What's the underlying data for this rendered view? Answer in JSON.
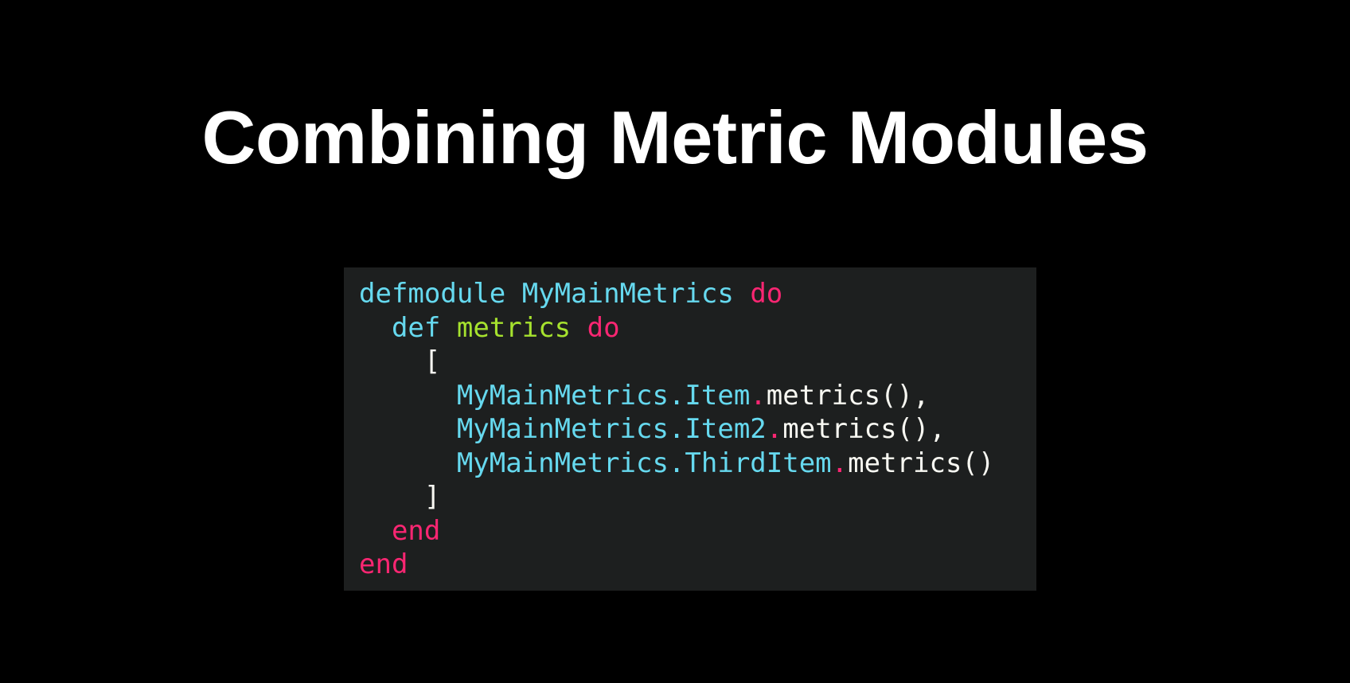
{
  "slide": {
    "title": "Combining Metric Modules"
  },
  "colors": {
    "background": "#000000",
    "code_background": "#1d1f1f",
    "keyword_blue": "#66d9ef",
    "keyword_red": "#f92672",
    "function_green": "#a6e22e",
    "plain_text": "#f8f8f2"
  },
  "code": {
    "language": "elixir",
    "lines": [
      [
        {
          "t": "defmodule",
          "c": "kw"
        },
        {
          "t": " ",
          "c": "plain"
        },
        {
          "t": "MyMainMetrics",
          "c": "type"
        },
        {
          "t": " ",
          "c": "plain"
        },
        {
          "t": "do",
          "c": "red"
        }
      ],
      [
        {
          "t": "  ",
          "c": "plain"
        },
        {
          "t": "def",
          "c": "kw"
        },
        {
          "t": " ",
          "c": "plain"
        },
        {
          "t": "metrics",
          "c": "fn"
        },
        {
          "t": " ",
          "c": "plain"
        },
        {
          "t": "do",
          "c": "red"
        }
      ],
      [
        {
          "t": "    [",
          "c": "plain"
        }
      ],
      [
        {
          "t": "      ",
          "c": "plain"
        },
        {
          "t": "MyMainMetrics.Item",
          "c": "type"
        },
        {
          "t": ".",
          "c": "red"
        },
        {
          "t": "metrics(),",
          "c": "plain"
        }
      ],
      [
        {
          "t": "      ",
          "c": "plain"
        },
        {
          "t": "MyMainMetrics.Item2",
          "c": "type"
        },
        {
          "t": ".",
          "c": "red"
        },
        {
          "t": "metrics(),",
          "c": "plain"
        }
      ],
      [
        {
          "t": "      ",
          "c": "plain"
        },
        {
          "t": "MyMainMetrics.ThirdItem",
          "c": "type"
        },
        {
          "t": ".",
          "c": "red"
        },
        {
          "t": "metrics()",
          "c": "plain"
        }
      ],
      [
        {
          "t": "    ]",
          "c": "plain"
        }
      ],
      [
        {
          "t": "  ",
          "c": "plain"
        },
        {
          "t": "end",
          "c": "red"
        }
      ],
      [
        {
          "t": "end",
          "c": "red"
        }
      ]
    ]
  }
}
